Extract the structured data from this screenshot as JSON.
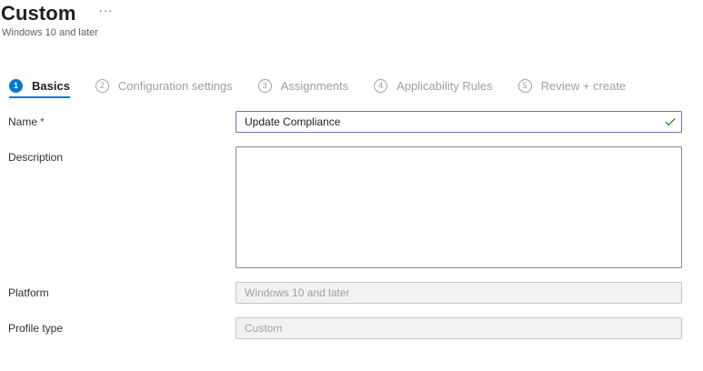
{
  "header": {
    "title": "Custom",
    "more_label": "···",
    "subtitle": "Windows 10 and later"
  },
  "steps": [
    {
      "number": "1",
      "label": "Basics",
      "active": true
    },
    {
      "number": "2",
      "label": "Configuration settings",
      "active": false
    },
    {
      "number": "3",
      "label": "Assignments",
      "active": false
    },
    {
      "number": "4",
      "label": "Applicability Rules",
      "active": false
    },
    {
      "number": "5",
      "label": "Review + create",
      "active": false
    }
  ],
  "form": {
    "name": {
      "label": "Name",
      "required_mark": "*",
      "value": "Update Compliance",
      "valid": true
    },
    "description": {
      "label": "Description",
      "value": ""
    },
    "platform": {
      "label": "Platform",
      "value": "Windows 10 and later"
    },
    "profile_type": {
      "label": "Profile type",
      "value": "Custom"
    }
  },
  "colors": {
    "accent": "#0078d4",
    "focus_border": "#8764b8",
    "required": "#a4262c",
    "disabled_bg": "#f3f2f1"
  },
  "icons": {
    "more": "more-icon",
    "valid": "checkmark-icon"
  }
}
